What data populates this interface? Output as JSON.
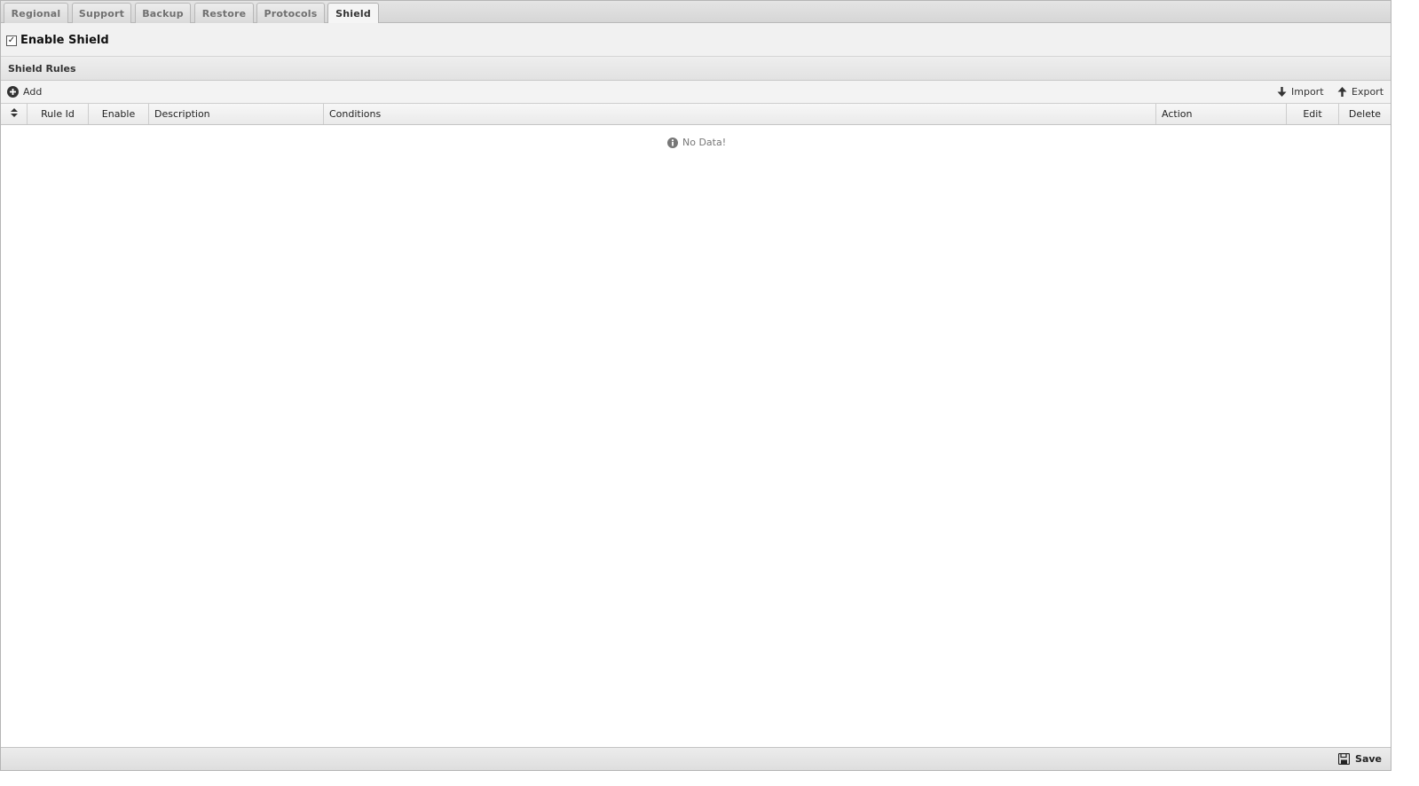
{
  "tabs": [
    {
      "label": "Regional"
    },
    {
      "label": "Support"
    },
    {
      "label": "Backup"
    },
    {
      "label": "Restore"
    },
    {
      "label": "Protocols"
    },
    {
      "label": "Shield"
    }
  ],
  "active_tab": "Shield",
  "enable": {
    "label": "Enable Shield",
    "checked": true
  },
  "section": {
    "title": "Shield Rules"
  },
  "toolbar": {
    "add_label": "Add",
    "import_label": "Import",
    "export_label": "Export"
  },
  "table": {
    "columns": [
      "Rule Id",
      "Enable",
      "Description",
      "Conditions",
      "Action",
      "Edit",
      "Delete"
    ],
    "empty_message": "No Data!"
  },
  "footer": {
    "save_label": "Save"
  },
  "icons": {
    "add": "plus-circle-icon",
    "import": "arrow-down-icon",
    "export": "arrow-up-icon",
    "sort": "sort-icon",
    "info": "info-icon",
    "save": "floppy-disk-icon"
  }
}
